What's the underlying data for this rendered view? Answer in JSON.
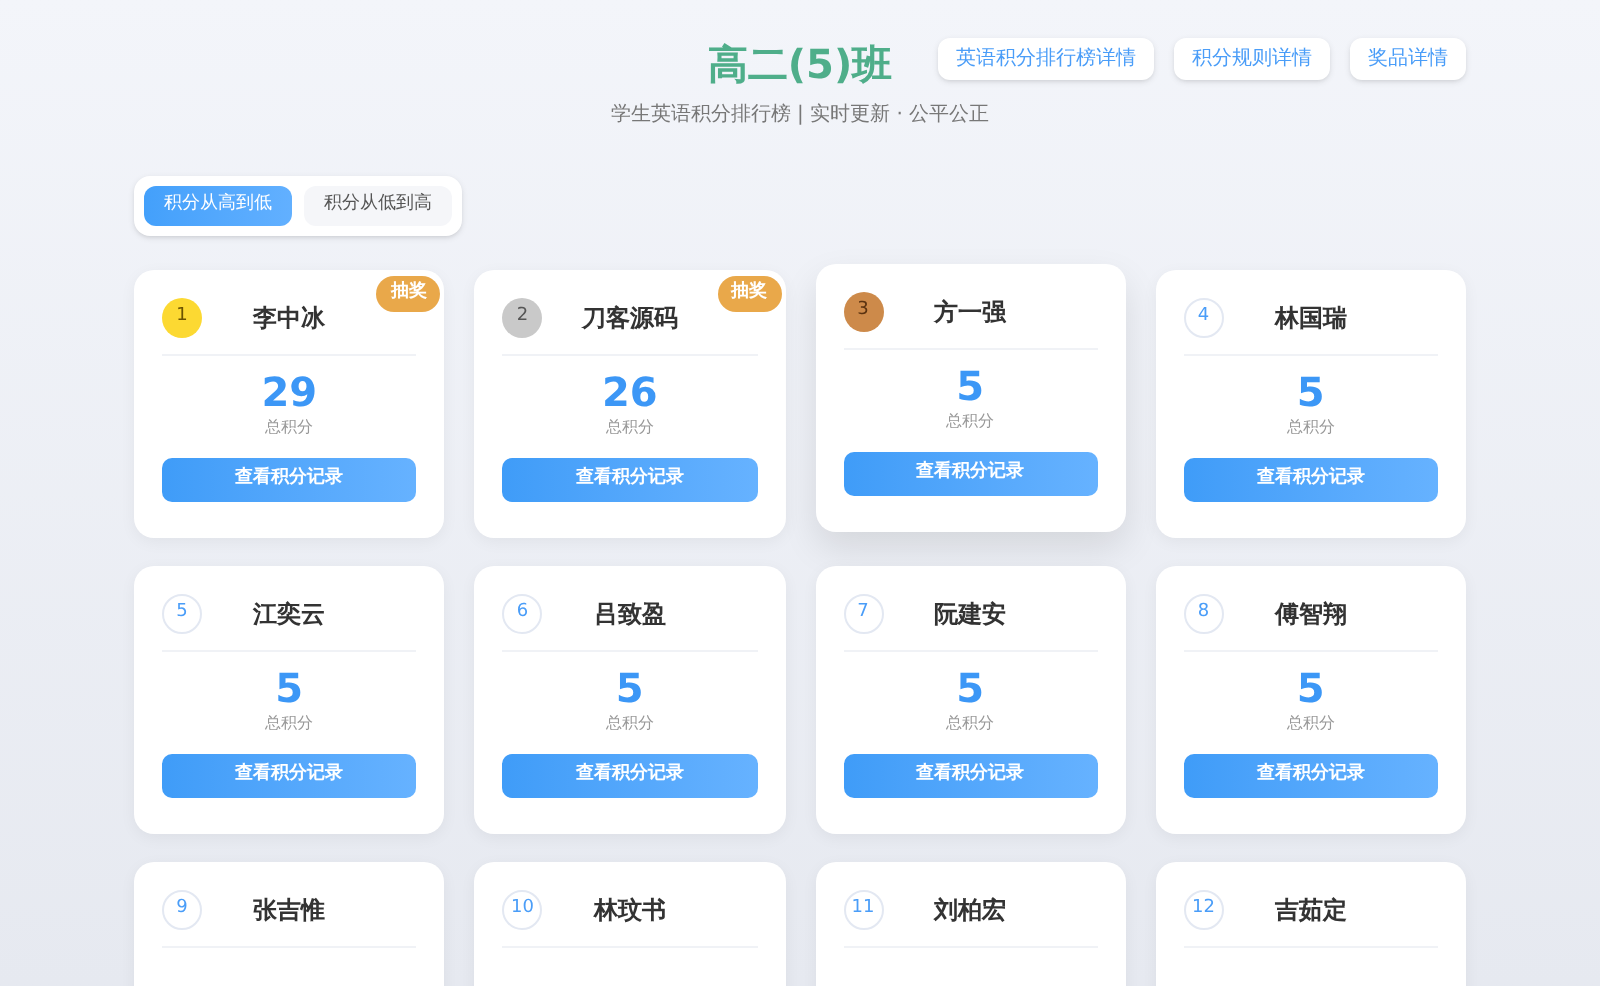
{
  "header": {
    "title": "高二(5)班",
    "subtitle": "学生英语积分排行榜 | 实时更新 · 公平公正",
    "links": [
      "英语积分排行榜详情",
      "积分规则详情",
      "奖品详情"
    ]
  },
  "sort_tabs": [
    {
      "label": "积分从高到低",
      "selected": true
    },
    {
      "label": "积分从低到高",
      "selected": false
    }
  ],
  "cards": [
    {
      "rank": "1",
      "kind": "gold",
      "name": "李中冰",
      "score": "29",
      "score_label": "总积分",
      "button": "查看积分记录",
      "badge": "抽奖",
      "hovered": false
    },
    {
      "rank": "2",
      "kind": "silver",
      "name": "刀客源码",
      "score": "26",
      "score_label": "总积分",
      "button": "查看积分记录",
      "badge": "抽奖",
      "hovered": false
    },
    {
      "rank": "3",
      "kind": "bronze",
      "name": "方一强",
      "score": "5",
      "score_label": "总积分",
      "button": "查看积分记录",
      "hovered": true
    },
    {
      "rank": "4",
      "kind": "plain",
      "name": "林国瑞",
      "score": "5",
      "score_label": "总积分",
      "button": "查看积分记录",
      "hovered": false
    },
    {
      "rank": "5",
      "kind": "plain",
      "name": "江奕云",
      "score": "5",
      "score_label": "总积分",
      "button": "查看积分记录",
      "hovered": false
    },
    {
      "rank": "6",
      "kind": "plain",
      "name": "吕致盈",
      "score": "5",
      "score_label": "总积分",
      "button": "查看积分记录",
      "hovered": false
    },
    {
      "rank": "7",
      "kind": "plain",
      "name": "阮建安",
      "score": "5",
      "score_label": "总积分",
      "button": "查看积分记录",
      "hovered": false
    },
    {
      "rank": "8",
      "kind": "plain",
      "name": "傅智翔",
      "score": "5",
      "score_label": "总积分",
      "button": "查看积分记录",
      "hovered": false
    },
    {
      "rank": "9",
      "kind": "plain",
      "name": "张吉惟",
      "hovered": false
    },
    {
      "rank": "10",
      "kind": "plain",
      "name": "林玟书",
      "hovered": false
    },
    {
      "rank": "11",
      "kind": "plain",
      "name": "刘柏宏",
      "hovered": false
    },
    {
      "rank": "12",
      "kind": "plain",
      "name": "吉茹定",
      "hovered": false
    }
  ]
}
